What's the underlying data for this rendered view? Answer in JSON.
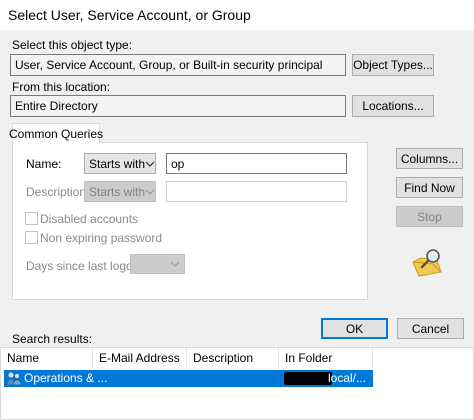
{
  "window": {
    "title": "Select User, Service Account, or Group"
  },
  "object_type": {
    "label": "Select this object type:",
    "value": "User, Service Account, Group, or Built-in security principal",
    "button": "Object Types..."
  },
  "location": {
    "label": "From this location:",
    "value": "Entire Directory",
    "button": "Locations..."
  },
  "queries": {
    "tab": "Common Queries",
    "name_label": "Name:",
    "name_match": "Starts with",
    "name_value": "op",
    "description_label": "Description:",
    "description_match": "Starts with",
    "description_value": "",
    "disabled_accounts": "Disabled accounts",
    "non_expiring": "Non expiring password",
    "days_label": "Days since last logon:",
    "days_value": ""
  },
  "side_buttons": {
    "columns": "Columns...",
    "find_now": "Find Now",
    "stop": "Stop"
  },
  "footer": {
    "ok": "OK",
    "cancel": "Cancel"
  },
  "results": {
    "label": "Search results:",
    "columns": [
      "Name",
      "E-Mail Address",
      "Description",
      "In Folder"
    ],
    "rows": [
      {
        "name": "Operations & ...",
        "email": "",
        "description": "",
        "folder": "local/..."
      }
    ]
  },
  "colors": {
    "accent": "#0078d7",
    "selection": "#0078d7",
    "dialog_bg": "#f0f0f0"
  },
  "icons": {
    "search_dialog": "magnifier-over-folder-icon",
    "row_icon": "user-group-icon"
  }
}
